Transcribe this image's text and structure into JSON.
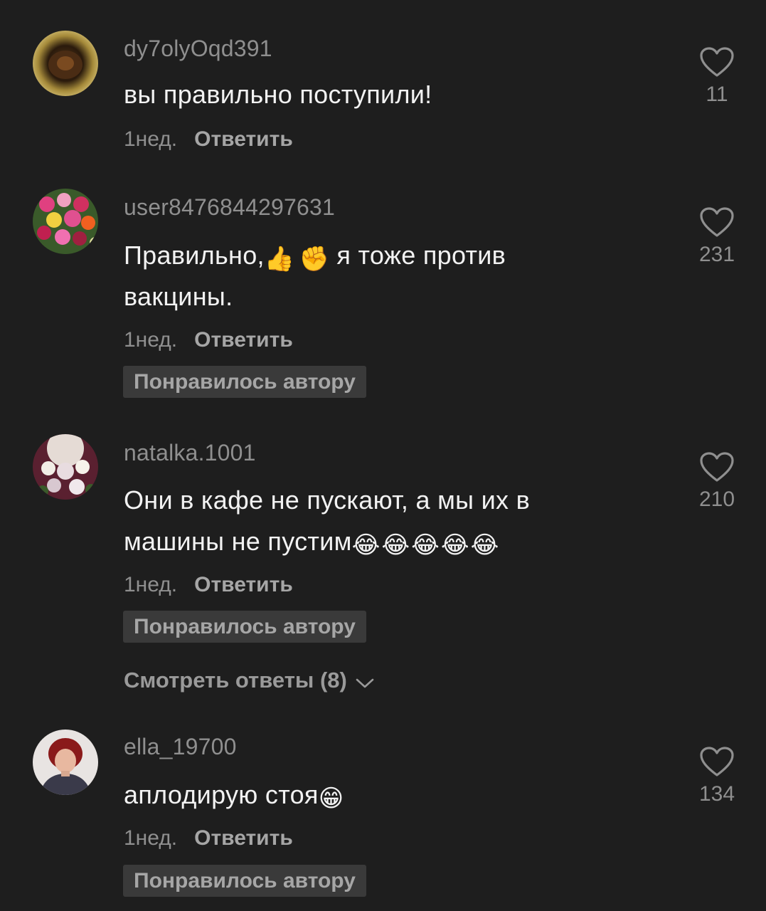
{
  "comments": [
    {
      "username": "dy7olyOqd391",
      "text": "вы правильно поступили!",
      "time": "1нед.",
      "reply": "Ответить",
      "likes": "11"
    },
    {
      "username": "user8476844297631",
      "text_a": "Правильно,",
      "emoji_1": "👍",
      "emoji_2": "✊",
      "text_b": "я тоже против вакцины.",
      "time": "1нед.",
      "reply": "Ответить",
      "badge": "Понравилось автору",
      "likes": "231"
    },
    {
      "username": "natalka.1001",
      "text_a": "Они в кафе не пускают, а мы их в машины не пустим",
      "emojis": "😂😂😂😂😂",
      "time": "1нед.",
      "reply": "Ответить",
      "badge": "Понравилось автору",
      "likes": "210",
      "view_replies": "Смотреть ответы (8)"
    },
    {
      "username": "ella_19700",
      "text_a": "аплодирую стоя",
      "emoji": "😁",
      "time": "1нед.",
      "reply": "Ответить",
      "badge": "Понравилось автору",
      "likes": "134"
    }
  ],
  "icons": {
    "like": "heart-outline-icon",
    "expand": "chevron-down-icon"
  },
  "colors": {
    "background": "#1e1e1e",
    "text": "#f2f2f2",
    "muted": "#8f8f8f",
    "badge_bg": "#3a3a3a"
  }
}
